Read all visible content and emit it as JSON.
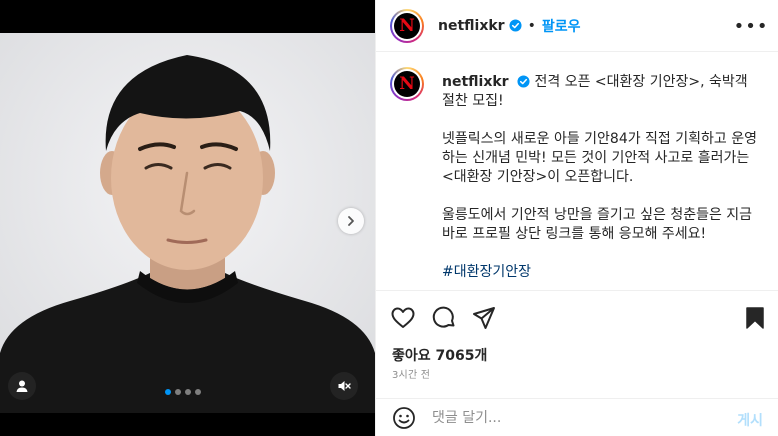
{
  "post": {
    "username": "netflixkr",
    "verified": true,
    "follow_label": "팔로우",
    "separator": "•",
    "more_label": "•••",
    "avatar_letter": "N",
    "caption_title": "전격 오픈 <대환장 기안장>, 숙박객 절찬 모집!",
    "caption_paragraphs": [
      "넷플릭스의 새로운 아들 기안84가 직접 기획하고 운영하는 신개념 민박! 모든 것이 기안적 사고로 흘러가는 <대환장 기안장>이 오픈합니다.",
      "울릉도에서 기안적 낭만을 즐기고 싶은 청춘들은 지금 바로 프로필 상단 링크를 통해 응모해 주세요!"
    ],
    "hashtag": "#대환장기안장",
    "likes": "좋아요 7065개",
    "time_ago": "3시간 전"
  },
  "media": {
    "carousel": {
      "total": 4,
      "active": 1
    }
  },
  "comment": {
    "placeholder": "댓글 달기...",
    "post_label": "게시"
  },
  "icons": {
    "like": "heart-icon",
    "comment": "comment-icon",
    "share": "paper-plane-icon",
    "save": "bookmark-icon",
    "emoji": "smiley-icon",
    "tag": "user-tag-icon",
    "mute": "speaker-muted-icon",
    "next": "chevron-right-icon"
  },
  "colors": {
    "brand_red": "#e50914",
    "link_blue": "#0095f6",
    "hashtag_blue": "#00376b"
  }
}
